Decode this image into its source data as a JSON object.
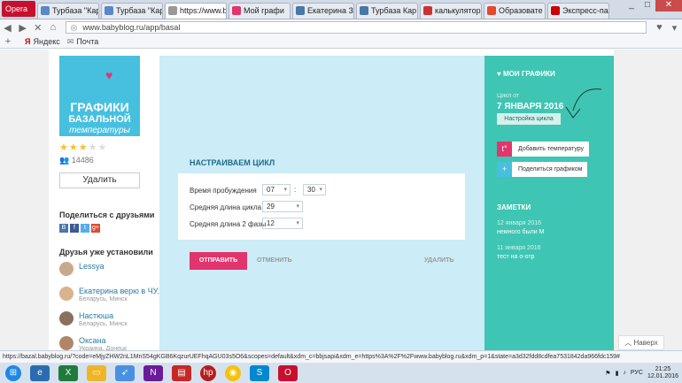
{
  "browser": {
    "opera_label": "Opera",
    "tabs": [
      {
        "title": "Турбаза \"Кар",
        "color": "#5b86c8"
      },
      {
        "title": "Турбаза \"Кар",
        "color": "#5b86c8"
      },
      {
        "title": "https://www.b",
        "color": "#999999"
      },
      {
        "title": "Мой графи",
        "color": "#e2356d"
      },
      {
        "title": "Екатерина Зу",
        "color": "#4a76a8"
      },
      {
        "title": "Турбаза Кар",
        "color": "#4a76a8"
      },
      {
        "title": "калькулятор",
        "color": "#cc3333"
      },
      {
        "title": "Образовате",
        "color": "#e24a2d"
      },
      {
        "title": "Экспресс-пан",
        "color": "#cc0000"
      }
    ],
    "url": "www.babyblog.ru/app/basal",
    "bookmarks": [
      "Яндекс",
      "Почта"
    ],
    "status_url": "https://bazal.babyblog.ru/?code=eMjyZHW2nL1MnS54gKGB6KqzurUEFhqAGU03s5O6&scopes=default&xdm_c=bbjsapi&xdm_e=https%3A%2F%2Fwww.babyblog.ru&xdm_p=1&state=a3d32fdd8cdfea7531842da966fdc159#"
  },
  "app": {
    "logo": {
      "line1": "ГРАФИКИ",
      "line2": "БАЗАЛЬНОЙ",
      "line3": "температуры"
    },
    "rating": {
      "filled": 3,
      "total": 5
    },
    "user_count": "14486",
    "delete_button": "Удалить",
    "share_title": "Поделиться с друзьями",
    "share_icons": [
      {
        "label": "В",
        "color": "#4a76a8"
      },
      {
        "label": "f",
        "color": "#3b5998"
      },
      {
        "label": "t",
        "color": "#55acee"
      },
      {
        "label": "g+",
        "color": "#dd4b39"
      }
    ],
    "friends_title": "Друзья уже установили",
    "friends": [
      {
        "name": "Lessya",
        "location": ""
      },
      {
        "name": "Екатерина верю в ЧУ.",
        "location": "Беларусь, Минск"
      },
      {
        "name": "Настюша",
        "location": "Беларусь, Минск"
      },
      {
        "name": "Оксана",
        "location": "Украина, Донецк"
      }
    ]
  },
  "form": {
    "title": "НАСТРАИВАЕМ ЦИКЛ",
    "wake_label": "Время пробуждения",
    "wake_hour": "07",
    "wake_sep": ":",
    "wake_min": "30",
    "cycle_label": "Средняя длина цикла",
    "cycle_value": "29",
    "phase_label": "Средняя длина 2 фазы",
    "phase_value": "12",
    "send": "ОТПРАВИТЬ",
    "cancel": "ОТМЕНИТЬ",
    "delete": "УДАЛИТЬ"
  },
  "sidebar": {
    "my_graphs": "МОИ ГРАФИКИ",
    "cycle_from": "Цикл от",
    "cycle_date": "7 ЯНВАРЯ 2016",
    "cycle_settings": "Настройка цикла",
    "add_temp": "Добавить температуру",
    "share_graph": "Поделиться графиком",
    "notes_title": "ЗАМЕТКИ",
    "notes": [
      {
        "date": "12 января 2016",
        "text": "немного были М"
      },
      {
        "date": "11 января 2016",
        "text": "тест на о-отр"
      }
    ],
    "back_to_top": "Наверх"
  },
  "taskbar": {
    "lang": "РУС",
    "time": "21:25",
    "date": "12.01.2016"
  }
}
